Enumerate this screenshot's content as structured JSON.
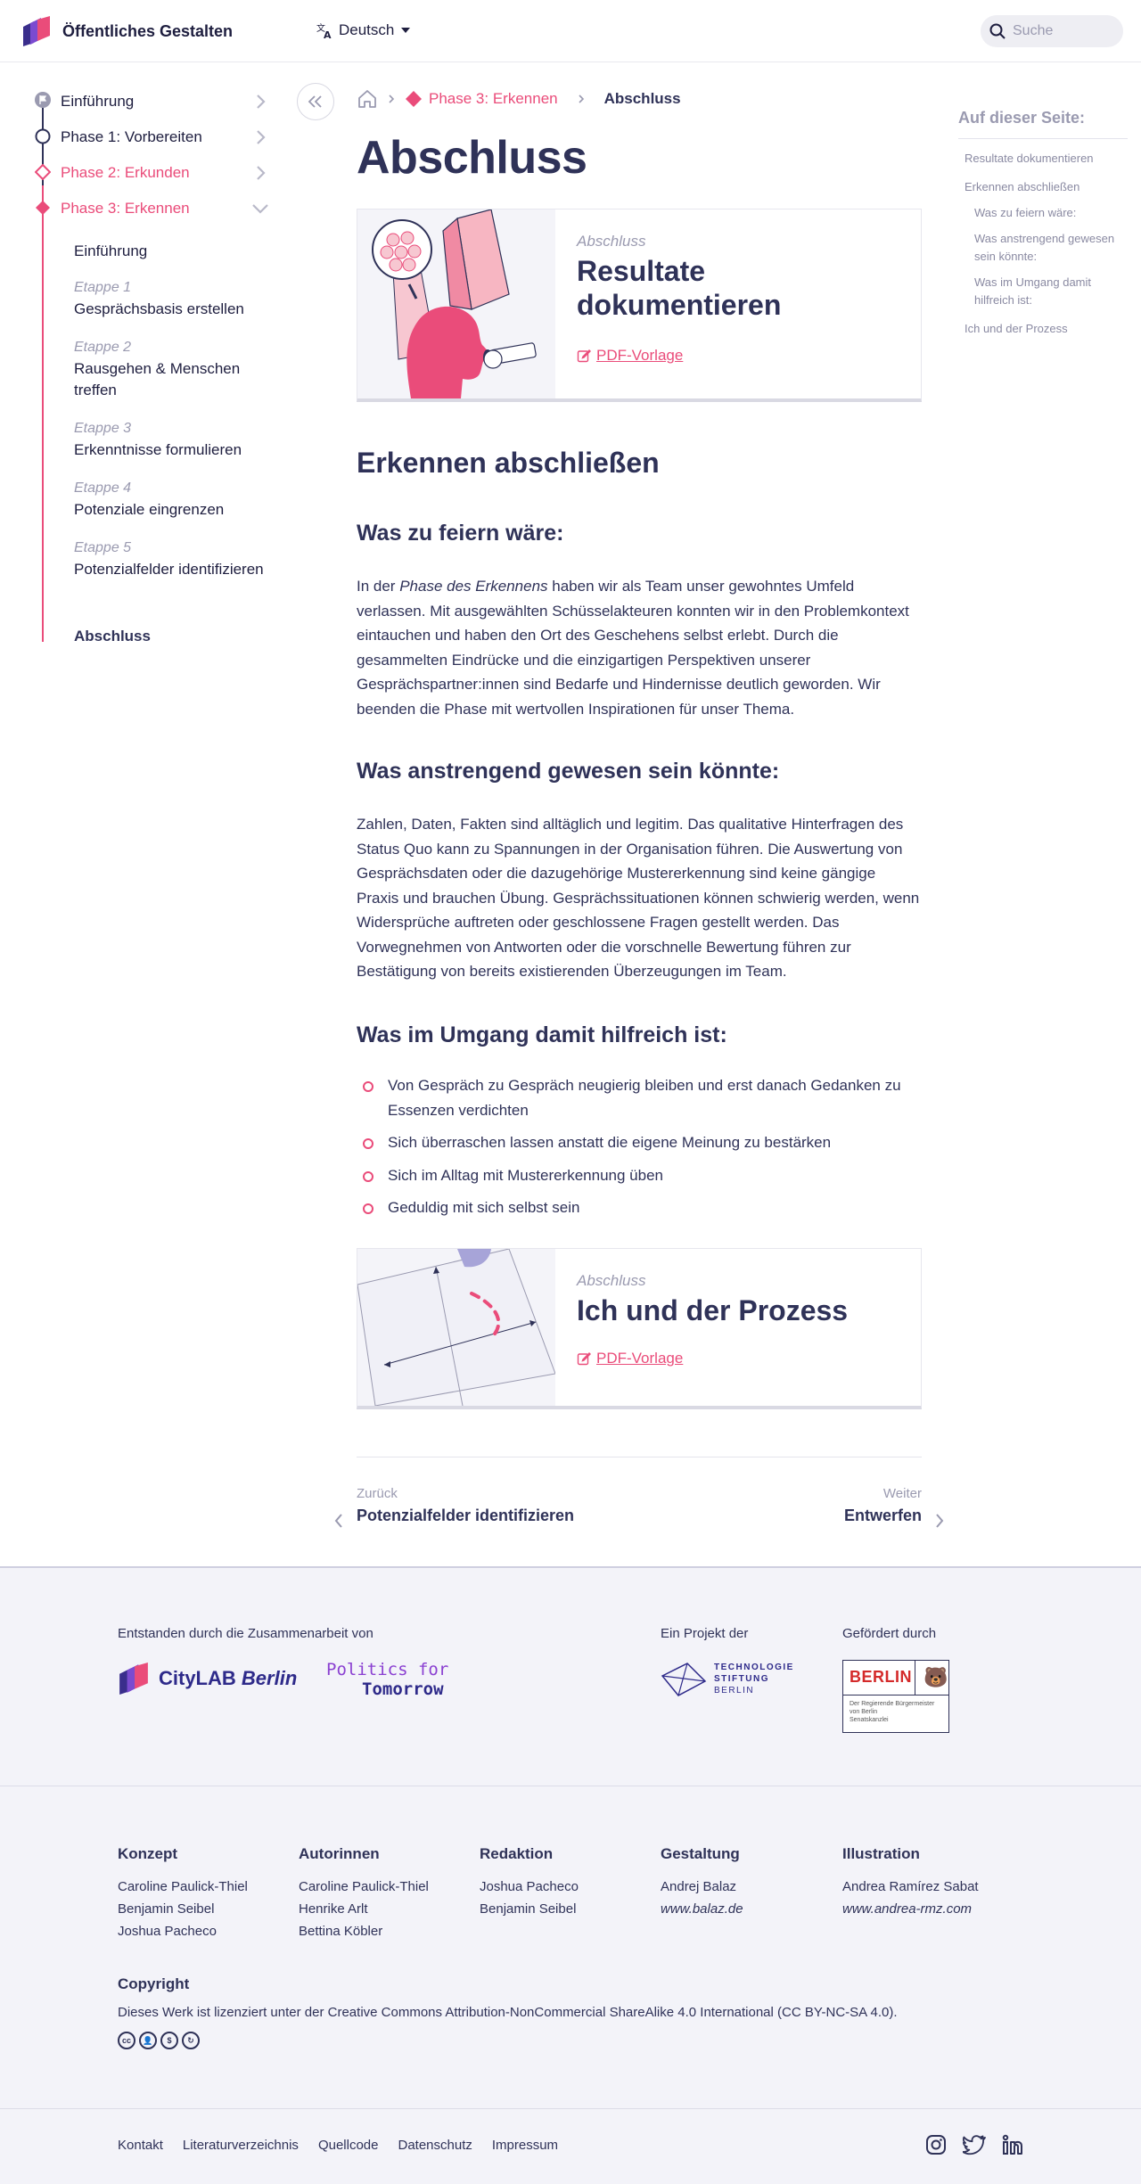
{
  "header": {
    "brand": "Öffentliches Gestalten",
    "language": "Deutsch",
    "search_placeholder": "Suche"
  },
  "sidebar": {
    "phases": [
      {
        "label": "Einführung"
      },
      {
        "label": "Phase 1: Vorbereiten"
      },
      {
        "label": "Phase 2: Erkunden"
      },
      {
        "label": "Phase 3: Erkennen"
      }
    ],
    "subitems": [
      {
        "etappe": "",
        "label": "Einführung"
      },
      {
        "etappe": "Etappe 1",
        "label": "Gesprächsbasis erstellen"
      },
      {
        "etappe": "Etappe 2",
        "label": "Rausgehen & Menschen treffen"
      },
      {
        "etappe": "Etappe 3",
        "label": "Erkenntnisse formulieren"
      },
      {
        "etappe": "Etappe 4",
        "label": "Potenziale eingrenzen"
      },
      {
        "etappe": "Etappe 5",
        "label": "Potenzialfelder identifizieren"
      },
      {
        "etappe": "",
        "label": "Abschluss"
      }
    ]
  },
  "breadcrumb": {
    "phase": "Phase 3: Erkennen",
    "current": "Abschluss"
  },
  "main": {
    "title": "Abschluss",
    "card1": {
      "kicker": "Abschluss",
      "title": "Resultate dokumentieren",
      "pdf": "PDF-Vorlage"
    },
    "section_title": "Erkennen abschließen",
    "h_celebrate": "Was zu feiern wäre:",
    "p_celebrate_before": "In der ",
    "p_celebrate_em": "Phase des Erkennens",
    "p_celebrate_after": " haben wir als Team unser gewohntes Umfeld verlassen. Mit ausgewählten Schüsselakteuren konnten wir in den Problemkontext eintauchen und haben den Ort des Geschehens selbst erlebt. Durch die gesammelten Eindrücke und die einzigartigen Perspektiven unserer Gesprächspartner:innen sind Bedarfe und Hindernisse deutlich geworden. Wir beenden die Phase mit wertvollen Inspirationen für unser Thema.",
    "h_hard": "Was anstrengend gewesen sein könnte:",
    "p_hard": "Zahlen, Daten, Fakten sind alltäglich und legitim. Das qualitative Hinterfragen des Status Quo kann zu Spannungen in der Organisation führen. Die Auswertung von Gesprächsdaten oder die dazugehörige Mustererkennung sind keine gängige Praxis und brauchen Übung. Gesprächssituationen können schwierig werden, wenn Widersprüche auftreten oder geschlossene Fragen gestellt werden. Das Vorwegnehmen von Antworten oder die vorschnelle Bewertung führen zur Bestätigung von bereits existierenden Überzeugungen im Team.",
    "h_help": "Was im Umgang damit hilfreich ist:",
    "tips": [
      "Von Gespräch zu Gespräch neugierig bleiben und erst danach Gedanken zu Essenzen verdichten",
      "Sich überraschen lassen anstatt die eigene Meinung zu bestärken",
      "Sich im Alltag mit Mustererkennung üben",
      "Geduldig mit sich selbst sein"
    ],
    "card2": {
      "kicker": "Abschluss",
      "title": "Ich und der Prozess",
      "pdf": "PDF-Vorlage"
    },
    "pager": {
      "prev_label": "Zurück",
      "prev_title": "Potenzialfelder identifizieren",
      "next_label": "Weiter",
      "next_title": "Entwerfen"
    }
  },
  "toc": {
    "title": "Auf dieser Seite:",
    "items": [
      "Resultate dokumentieren",
      "Erkennen abschließen",
      "Was zu feiern wäre:",
      "Was anstrengend gewesen sein könnte:",
      "Was im Umgang damit hilfreich ist:",
      "Ich und der Prozess"
    ]
  },
  "footer": {
    "collab_label": "Entstanden durch die Zusammenarbeit von",
    "citylab_a": "CityLAB",
    "citylab_b": "Berlin",
    "politics_line1": "Politics for",
    "politics_line2": "Tomorrow",
    "project_label": "Ein Projekt der",
    "tsb_line1": "TECHNOLOGIE",
    "tsb_line2": "STIFTUNG",
    "tsb_line3": "BERLIN",
    "funded_label": "Gefördert durch",
    "berlin_word": "BERLIN",
    "berlin_sub1": "Der Regierende Bürgermeister",
    "berlin_sub2": "von Berlin",
    "berlin_sub3": "Senatskanzlei",
    "credits": [
      {
        "title": "Konzept",
        "names": [
          "Caroline Paulick-Thiel",
          "Benjamin Seibel",
          "Joshua Pacheco"
        ]
      },
      {
        "title": "Autorinnen",
        "names": [
          "Caroline Paulick-Thiel",
          "Henrike Arlt",
          "Bettina Köbler"
        ]
      },
      {
        "title": "Redaktion",
        "names": [
          "Joshua Pacheco",
          "Benjamin Seibel"
        ]
      },
      {
        "title": "Gestaltung",
        "names": [
          "Andrej Balaz",
          "www.balaz.de"
        ]
      },
      {
        "title": "Illustration",
        "names": [
          "Andrea Ramírez Sabat",
          "www.andrea-rmz.com"
        ]
      }
    ],
    "copyright_title": "Copyright",
    "copyright_text": "Dieses Werk ist lizenziert unter der Creative Commons Attribution-NonCommercial ShareAlike 4.0 International (CC BY-NC-SA 4.0).",
    "cc_icons": [
      "cc",
      "by",
      "nc",
      "sa"
    ],
    "links": [
      "Kontakt",
      "Literaturverzeichnis",
      "Quellcode",
      "Datenschutz",
      "Impressum"
    ],
    "social": [
      "instagram-icon",
      "twitter-icon",
      "linkedin-icon"
    ]
  },
  "colors": {
    "accent": "#ea4c7a",
    "text": "#2f3258",
    "muted": "#9a9ab0",
    "footer_bg": "#f3f3f9"
  }
}
